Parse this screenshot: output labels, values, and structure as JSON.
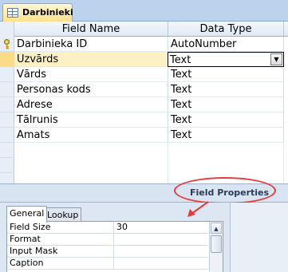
{
  "window": {
    "tab_title": "Darbinieki",
    "tab_icon": "table-icon"
  },
  "grid": {
    "columns": [
      "Field Name",
      "Data Type"
    ],
    "rows": [
      {
        "field": "Darbinieka ID",
        "type": "AutoNumber",
        "primary_key": true
      },
      {
        "field": "Uzvārds",
        "type": "Text",
        "current": true
      },
      {
        "field": "Vārds",
        "type": "Text"
      },
      {
        "field": "Personas kods",
        "type": "Text"
      },
      {
        "field": "Adrese",
        "type": "Text"
      },
      {
        "field": "Tālrunis",
        "type": "Text"
      },
      {
        "field": "Amats",
        "type": "Text"
      }
    ],
    "dropdown_icon": "chevron-down-icon"
  },
  "field_properties": {
    "title": "Field Properties",
    "tabs": [
      "General",
      "Lookup"
    ],
    "active_tab": "General",
    "rows": [
      {
        "name": "Field Size",
        "value": "30"
      },
      {
        "name": "Format",
        "value": ""
      },
      {
        "name": "Input Mask",
        "value": ""
      },
      {
        "name": "Caption",
        "value": ""
      }
    ]
  },
  "colors": {
    "annotation_red": "#e53b3b",
    "current_row": "#fdf0c4",
    "header_blue": "#dfe8f3"
  }
}
